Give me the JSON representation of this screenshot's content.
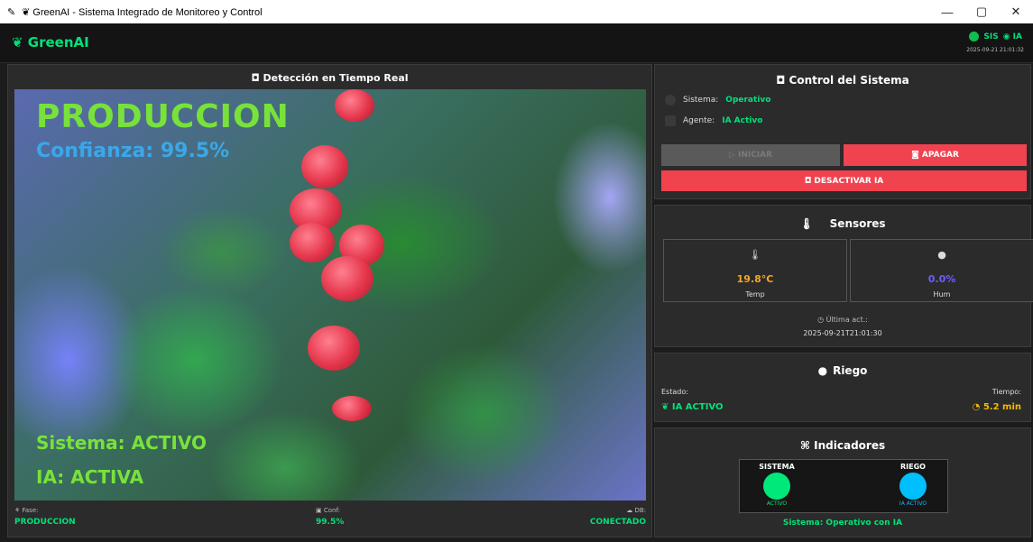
{
  "window": {
    "icon": "✎",
    "title": "❦ GreenAI - Sistema Integrado de Monitoreo y Control",
    "controls": {
      "minimize": "—",
      "maximize": "▢",
      "close": "✕"
    }
  },
  "header": {
    "brand": "❦ GreenAI",
    "status_sys": "SIS",
    "status_ia": "◉ IA",
    "timestamp": "2025-09-21 21:01:32"
  },
  "camera": {
    "title": "◘ Detección en Tiempo Real",
    "overlay": {
      "phase": "PRODUCCION",
      "confidence": "Confianza: 99.5%",
      "system": "Sistema: ACTIVO",
      "ia": "IA: ACTIVA"
    },
    "footer": {
      "phase_label": "⚘ Fase:",
      "phase_value": "PRODUCCION",
      "conf_label": "▣ Conf:",
      "conf_value": "99.5%",
      "db_label": "☁ DB:",
      "db_value": "CONECTADO"
    }
  },
  "control": {
    "title": "◘ Control del Sistema",
    "sistema_label": "Sistema:",
    "sistema_value": "Operativo",
    "agente_label": "Agente:",
    "agente_value": "IA Activo",
    "start_label": "▷ INICIAR",
    "stop_label": "◙ APAGAR",
    "deactivate_label": "◘ DESACTIVAR IA"
  },
  "sensors": {
    "title": "Sensores",
    "temp_value": "19.8°C",
    "temp_label": "Temp",
    "hum_value": "0.0%",
    "hum_label": "Hum",
    "updated_label": "◷ Última act.:",
    "updated_value": "2025-09-21T21:01:30",
    "colors": {
      "temp": "#f5a623",
      "hum": "#6d5cff"
    }
  },
  "riego": {
    "title": "Riego",
    "estado_label": "Estado:",
    "estado_value": "❦ IA ACTIVO",
    "tiempo_label": "Tiempo:",
    "tiempo_value": "◔ 5.2 min"
  },
  "indicators": {
    "title": "⌘ Indicadores",
    "sistema_title": "SISTEMA",
    "sistema_state": "ACTIVO",
    "riego_title": "RIEGO",
    "riego_state": "IA ACTIVO",
    "summary": "Sistema: Operativo con IA",
    "colors": {
      "sistema": "#00e87a",
      "riego": "#00bfff"
    }
  }
}
